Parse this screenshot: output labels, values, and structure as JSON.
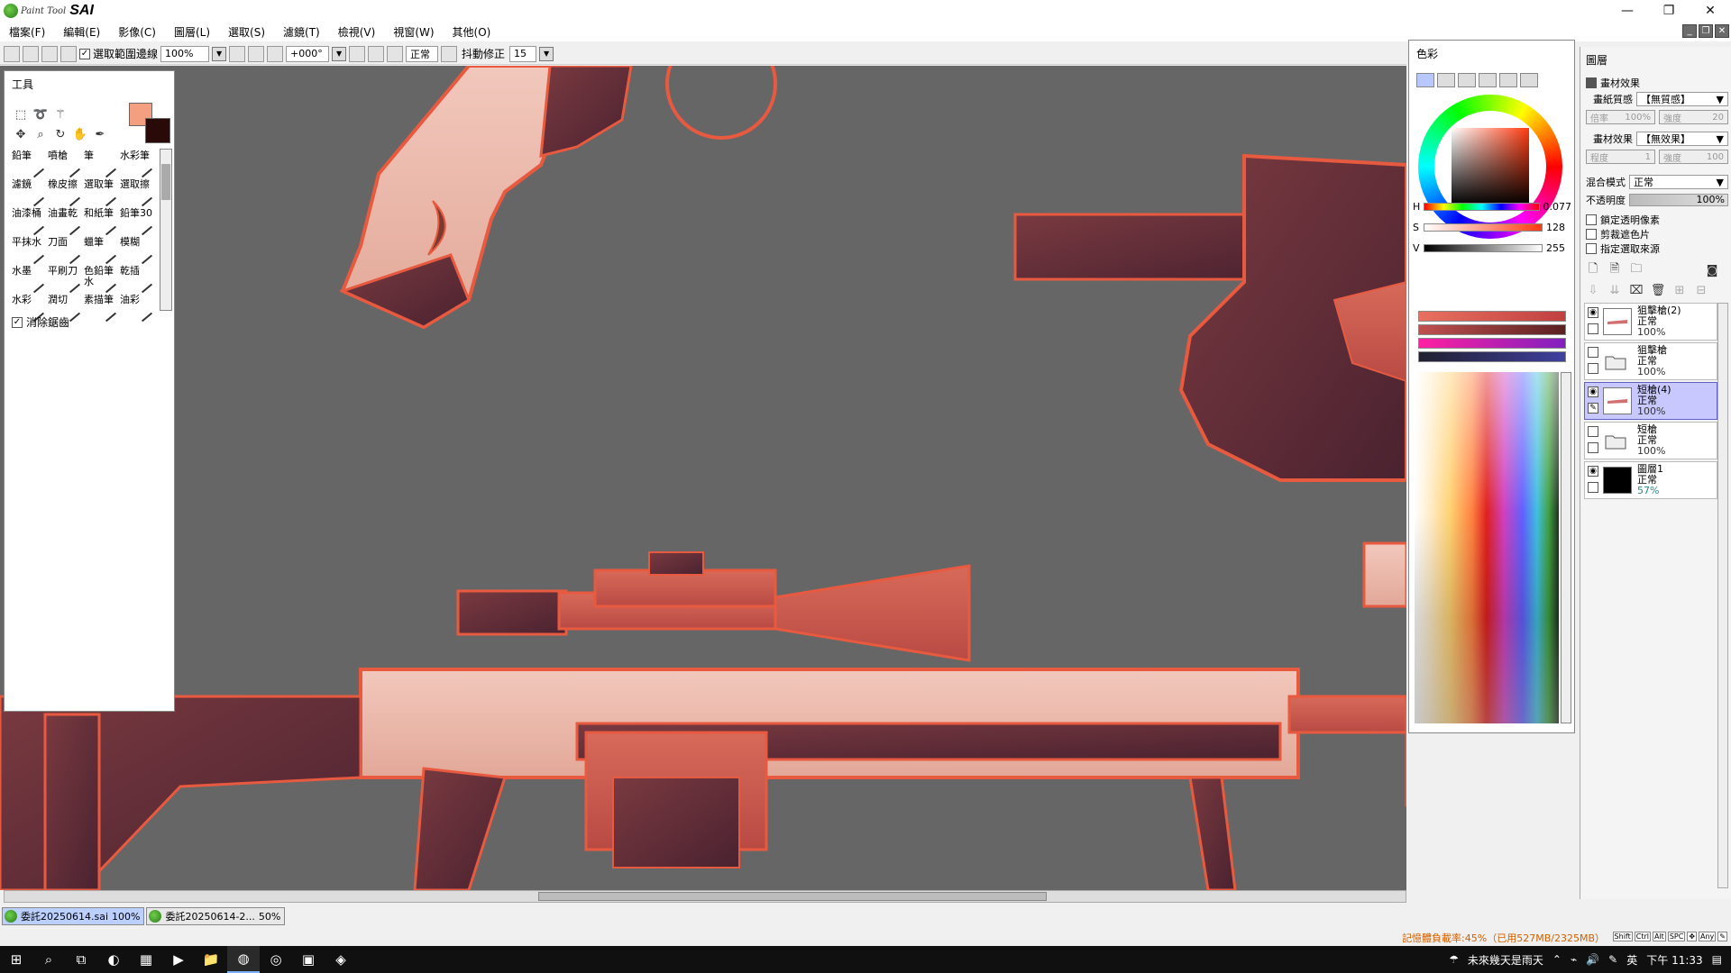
{
  "app": {
    "title_small": "Paint Tool",
    "title_big": "SAI",
    "window_buttons": [
      "—",
      "❐",
      "✕"
    ]
  },
  "menu": [
    "檔案(F)",
    "編輯(E)",
    "影像(C)",
    "圖層(L)",
    "選取(S)",
    "濾鏡(T)",
    "檢視(V)",
    "視窗(W)",
    "其他(O)"
  ],
  "toolbar": {
    "selection_outline_label": "選取範圍邊線",
    "zoom": "100%",
    "rotation": "+000°",
    "blend_label": "正常",
    "stabilizer_label": "抖動修正",
    "stabilizer_value": "15"
  },
  "tools_panel": {
    "title": "工具",
    "brushes": [
      "鉛筆",
      "噴槍",
      "筆",
      "水彩筆",
      "濾鏡",
      "橡皮擦",
      "選取筆",
      "選取擦",
      "油漆桶",
      "油畫乾",
      "和紙筆",
      "鉛筆30",
      "平抹水",
      "刀面",
      "蠟筆",
      "模糊",
      "水墨",
      "平刷刀",
      "色鉛筆水",
      "乾插",
      "水彩",
      "潤切",
      "素描筆",
      "油彩"
    ],
    "antialias_label": "消除鋸齒"
  },
  "color_panel": {
    "title": "色彩",
    "h_label": "H",
    "h_value": "0.077",
    "s_label": "S",
    "s_value": "128",
    "v_label": "V",
    "v_value": "255",
    "fg_color": "#f4a080",
    "bg_color": "#2a0a08"
  },
  "layer_panel": {
    "title": "圖層",
    "effects_header": "畫材效果",
    "paper_texture_label": "畫紙質感",
    "paper_texture_value": "【無質感】",
    "scale_label": "倍率",
    "scale_value": "100%",
    "strength_label": "強度",
    "strength_value": "20",
    "material_effect_label": "畫材效果",
    "material_effect_value": "【無效果】",
    "degree_label": "程度",
    "degree_value": "1",
    "strength2_label": "強度",
    "strength2_value": "100",
    "blend_mode_label": "混合模式",
    "blend_mode_value": "正常",
    "opacity_label": "不透明度",
    "opacity_value": "100%",
    "lock_transparency": "鎖定透明像素",
    "clipping": "剪裁遮色片",
    "selection_source": "指定選取來源",
    "layers": [
      {
        "name": "狙擊槍(2)",
        "mode": "正常",
        "opacity": "100%",
        "visible": true,
        "kind": "layer",
        "selected": false
      },
      {
        "name": "狙擊槍",
        "mode": "正常",
        "opacity": "100%",
        "visible": false,
        "kind": "folder",
        "selected": false
      },
      {
        "name": "短槍(4)",
        "mode": "正常",
        "opacity": "100%",
        "visible": true,
        "kind": "layer",
        "selected": true
      },
      {
        "name": "短槍",
        "mode": "正常",
        "opacity": "100%",
        "visible": false,
        "kind": "folder",
        "selected": false
      },
      {
        "name": "圖層1",
        "mode": "正常",
        "opacity": "57%",
        "visible": true,
        "kind": "black",
        "selected": false
      }
    ]
  },
  "documents": [
    {
      "name": "委託20250614.sai",
      "zoom": "100%",
      "active": true
    },
    {
      "name": "委託20250614-2...",
      "zoom": "50%",
      "active": false
    }
  ],
  "status": {
    "memory": "記憶體負載率:45%（已用527MB/2325MB）",
    "keys": [
      "Shift",
      "Ctrl",
      "Alt",
      "SPC",
      "✥",
      "Any",
      "✎"
    ]
  },
  "taskbar": {
    "weather": "未來幾天是雨天",
    "ime": "英",
    "time": "下午 11:33"
  }
}
